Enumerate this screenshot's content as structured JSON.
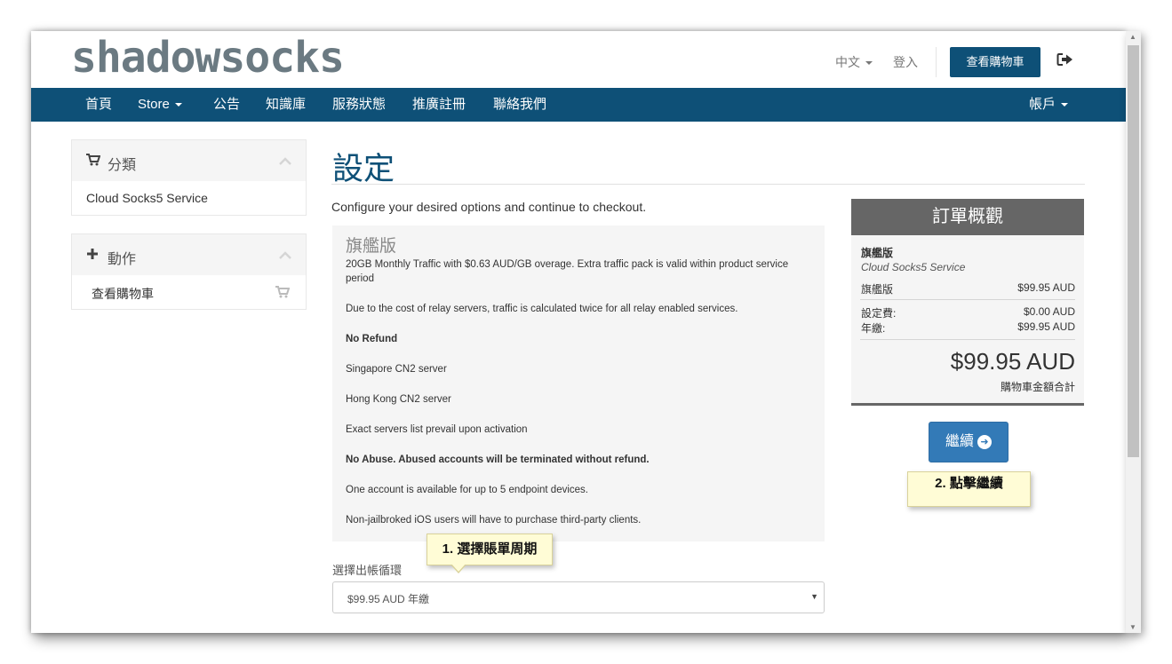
{
  "header": {
    "logo": "shadowsocks",
    "language": "中文",
    "login": "登入",
    "view_cart": "查看購物車"
  },
  "nav": {
    "items": [
      "首頁",
      "Store",
      "公告",
      "知識庫",
      "服務狀態",
      "推廣註冊",
      "聯絡我們"
    ],
    "account": "帳戶"
  },
  "sidebar": {
    "categories": {
      "title": "分類",
      "items": [
        "Cloud Socks5 Service"
      ]
    },
    "actions": {
      "title": "動作",
      "items": [
        "查看購物車"
      ]
    }
  },
  "main": {
    "title": "設定",
    "subtitle": "Configure your desired options and continue to checkout.",
    "product": {
      "name": "旗艦版",
      "lines": [
        "20GB Monthly Traffic with $0.63 AUD/GB overage. Extra traffic pack is valid within product service period",
        "Due to the cost of relay servers, traffic is calculated twice for all relay enabled services.",
        "No Refund",
        "Singapore CN2 server",
        "Hong Kong CN2 server",
        "Exact servers list prevail upon activation",
        "No Abuse. Abused accounts will be terminated without refund.",
        "One account is available for up to 5 endpoint devices.",
        "Non-jailbroked iOS users will have to purchase third-party clients."
      ]
    },
    "billing_label": "選擇出帳循環",
    "billing_value": "$99.95 AUD 年繳"
  },
  "summary": {
    "title": "訂單概觀",
    "product": "旗艦版",
    "group": "Cloud Socks5 Service",
    "item_label": "旗艦版",
    "item_price": "$99.95 AUD",
    "setup_label": "設定費:",
    "setup_price": "$0.00 AUD",
    "annual_label": "年繳:",
    "annual_price": "$99.95 AUD",
    "total": "$99.95 AUD",
    "total_label": "購物車金額合計"
  },
  "continue_button": "繼續",
  "annotations": {
    "step1": "1. 選擇賬單周期",
    "step2": "2. 點擊繼續"
  },
  "colors": {
    "nav": "#0e5077",
    "button": "#337ab7",
    "tip": "#fffcd6"
  }
}
